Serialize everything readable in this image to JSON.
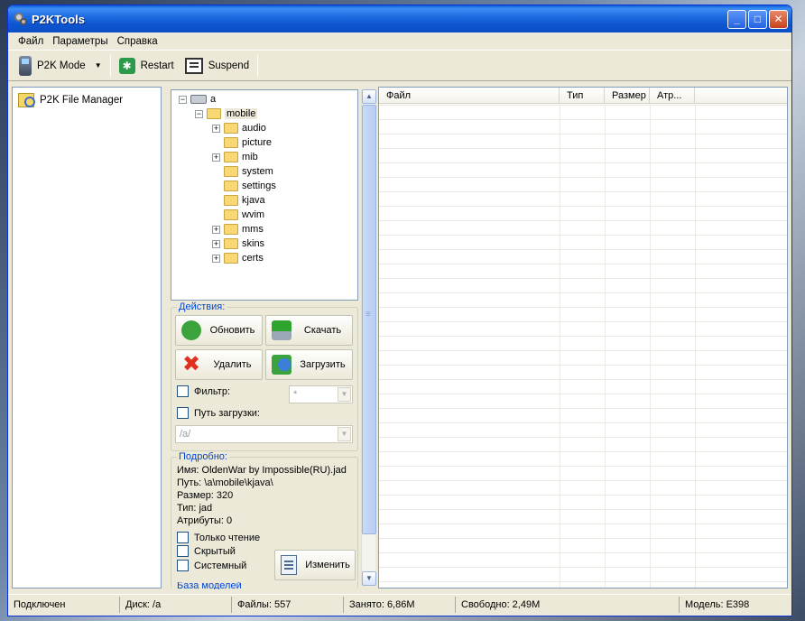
{
  "window": {
    "title": "P2KTools"
  },
  "menu": [
    "Файл",
    "Параметры",
    "Справка"
  ],
  "toolbar": {
    "mode_label": "P2K Mode",
    "restart_label": "Restart",
    "suspend_label": "Suspend"
  },
  "left_panel": {
    "items": [
      {
        "label": "P2K File Manager",
        "icon": "file-manager-icon"
      }
    ]
  },
  "tree": {
    "root": "a",
    "mobile": "mobile",
    "children": [
      "audio",
      "picture",
      "mib",
      "system",
      "settings",
      "kjava",
      "wvim",
      "mms",
      "skins",
      "certs"
    ]
  },
  "actions": {
    "title": "Действия:",
    "refresh": "Обновить",
    "download": "Скачать",
    "delete": "Удалить",
    "upload": "Загрузить",
    "filter_label": "Фильтр:",
    "filter_value": "*",
    "upload_path_label": "Путь загрузки:",
    "upload_path_value": "/a/"
  },
  "details": {
    "title": "Подробно:",
    "name": "Имя: OldenWar by Impossible(RU).jad",
    "path": "Путь: \\a\\mobile\\kjava\\",
    "size": "Размер: 320",
    "type": "Тип: jad",
    "attributes": "Атрибуты: 0",
    "readonly": "Только чтение",
    "hidden": "Скрытый",
    "system": "Системный",
    "edit": "Изменить",
    "next_section": "База моделей"
  },
  "list": {
    "columns": [
      "Файл",
      "Тип",
      "Размер",
      "Атр..."
    ]
  },
  "status": {
    "connected": "Подключен",
    "disk": "Диск: /a",
    "files": "Файлы: 557",
    "used": "Занято: 6,86M",
    "free": "Свободно: 2,49M",
    "model": "Модель: E398"
  }
}
